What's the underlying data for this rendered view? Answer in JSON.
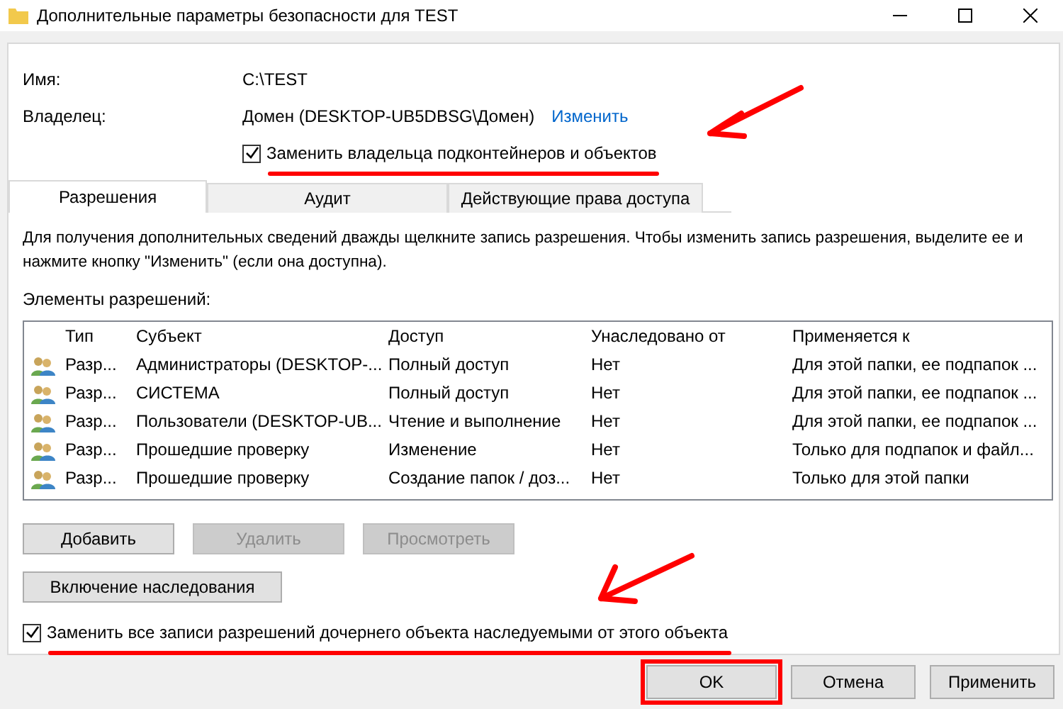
{
  "window": {
    "title": "Дополнительные параметры безопасности  для  TEST"
  },
  "fields": [
    {
      "label": "Имя:",
      "value": "C:\\TEST"
    },
    {
      "label": "Владелец:",
      "value": "Домен (DESKTOP-UB5DBSG\\Домен)",
      "link": "Изменить"
    }
  ],
  "owner_checkbox": {
    "label": "Заменить владельца подконтейнеров и объектов",
    "checked": true,
    "annotated": true
  },
  "tabs": [
    {
      "label": "Разрешения",
      "selected": true
    },
    {
      "label": "Аудит",
      "selected": false
    },
    {
      "label": "Действующие права доступа",
      "selected": false
    }
  ],
  "description": "Для получения дополнительных сведений дважды щелкните запись разрешения. Чтобы изменить запись разрешения, выделите ее и нажмите кнопку \"Изменить\" (если она доступна).",
  "table": {
    "caption": "Элементы разрешений:",
    "columns": [
      "Тип",
      "Субъект",
      "Доступ",
      "Унаследовано от",
      "Применяется к"
    ],
    "rows": [
      [
        "Разр...",
        "Администраторы (DESKTOP-...",
        "Полный доступ",
        "Нет",
        "Для этой папки, ее подпапок ..."
      ],
      [
        "Разр...",
        "СИСТЕМА",
        "Полный доступ",
        "Нет",
        "Для этой папки, ее подпапок ..."
      ],
      [
        "Разр...",
        "Пользователи (DESKTOP-UB...",
        "Чтение и выполнение",
        "Нет",
        "Для этой папки, ее подпапок ..."
      ],
      [
        "Разр...",
        "Прошедшие проверку",
        "Изменение",
        "Нет",
        "Только для подпапок и файл..."
      ],
      [
        "Разр...",
        "Прошедшие проверку",
        "Создание папок / доз...",
        "Нет",
        "Только для этой папки"
      ]
    ]
  },
  "actions": [
    {
      "label": "Добавить",
      "disabled": false
    },
    {
      "label": "Удалить",
      "disabled": true
    },
    {
      "label": "Просмотреть",
      "disabled": true
    }
  ],
  "inheritance_button": {
    "label": "Включение наследования"
  },
  "replace_checkbox": {
    "label": "Заменить все записи разрешений дочернего объекта наследуемыми от этого объекта",
    "checked": true,
    "annotated": true
  },
  "footer_buttons": [
    {
      "label": "OK",
      "highlighted": true
    },
    {
      "label": "Отмена",
      "highlighted": false
    },
    {
      "label": "Применить",
      "highlighted": false
    }
  ]
}
